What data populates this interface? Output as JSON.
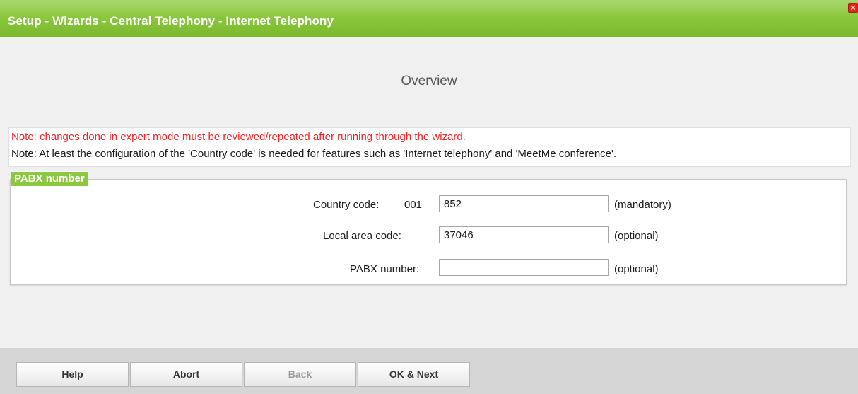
{
  "window": {
    "title": "Setup - Wizards - Central Telephony - Internet Telephony",
    "close_symbol": "×"
  },
  "heading": "Overview",
  "notes": {
    "warning": "Note: changes done in expert mode must be reviewed/repeated after running through the wizard.",
    "info": "Note: At least the configuration of the 'Country code' is needed for features such as 'Internet telephony' and 'MeetMe conference'."
  },
  "pabx_section": {
    "label": "PABX number",
    "country_code": {
      "label": "Country code:",
      "prefix": "001",
      "value": "852",
      "hint": "(mandatory)"
    },
    "local_area_code": {
      "label": "Local area code:",
      "value": "37046",
      "hint": "(optional)"
    },
    "pabx_number": {
      "label": "PABX number:",
      "value": "",
      "hint": "(optional)"
    }
  },
  "buttons": {
    "help": "Help",
    "abort": "Abort",
    "back": "Back",
    "ok_next": "OK & Next"
  },
  "colors": {
    "accent_green": "#8cc83f",
    "warning_red": "#ff2020",
    "close_red": "#e32b1d"
  }
}
